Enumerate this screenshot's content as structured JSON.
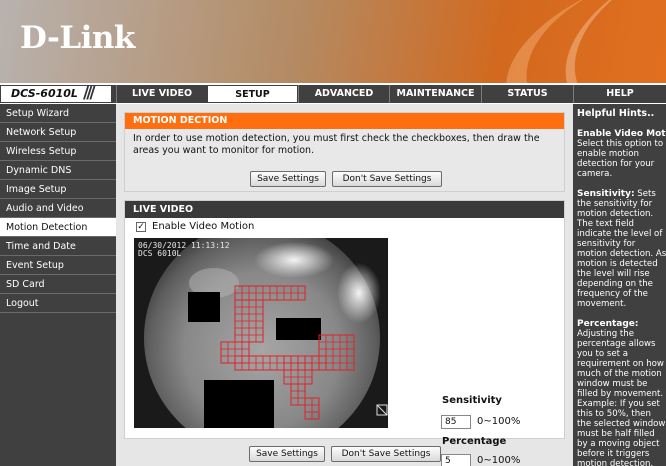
{
  "header": {
    "logo_text": "D-Link"
  },
  "nav": {
    "model": "DCS-6010L",
    "tabs": [
      {
        "label": "LIVE VIDEO"
      },
      {
        "label": "SETUP"
      },
      {
        "label": "ADVANCED"
      },
      {
        "label": "MAINTENANCE"
      },
      {
        "label": "STATUS"
      },
      {
        "label": "HELP"
      }
    ]
  },
  "sidebar": {
    "items": [
      {
        "label": "Setup Wizard"
      },
      {
        "label": "Network Setup"
      },
      {
        "label": "Wireless Setup"
      },
      {
        "label": "Dynamic DNS"
      },
      {
        "label": "Image Setup"
      },
      {
        "label": "Audio and Video"
      },
      {
        "label": "Motion Detection"
      },
      {
        "label": "Time and Date"
      },
      {
        "label": "Event Setup"
      },
      {
        "label": "SD Card"
      },
      {
        "label": "Logout"
      }
    ]
  },
  "motion": {
    "title": "MOTION DECTION",
    "description": "In order to use motion detection, you must first check the checkboxes, then draw the areas you want to monitor for motion.",
    "save_label": "Save Settings",
    "dont_save_label": "Don't Save Settings"
  },
  "live": {
    "title": "LIVE VIDEO",
    "enable_label": "Enable Video Motion",
    "enable_checked": true,
    "overlay_timestamp": "06/30/2012 11:13:12",
    "overlay_model": "DCS 6010L",
    "sensitivity_label": "Sensitivity",
    "sensitivity_value": "85",
    "sensitivity_range": "0~100%",
    "percentage_label": "Percentage",
    "percentage_value": "5",
    "percentage_range": "0~100%"
  },
  "bottom": {
    "save_label": "Save Settings",
    "dont_save_label": "Don't Save Settings"
  },
  "hints": {
    "title": "Helpful Hints..",
    "items": [
      {
        "heading": "Enable Video Motion",
        "text": "Select this option to enable motion detection for your camera."
      },
      {
        "heading": "Sensitivity:",
        "text": "Sets the sensitivity for motion detection. The text field indicate the level of sensitivity for motion detection. As motion is detected the level will rise depending on the frequency of the movement."
      },
      {
        "heading": "Percentage:",
        "text": "Adjusting the percentage allows you to set a requirement on how much of the motion window must be filled by movement. Example: If you set this to 50%, then the selected window must be half filled by a moving object before it triggers motion detection."
      }
    ]
  },
  "colors": {
    "accent_orange": "#ff6f0f",
    "nav_dark": "#404040",
    "motion_grid": "#e0202a"
  }
}
